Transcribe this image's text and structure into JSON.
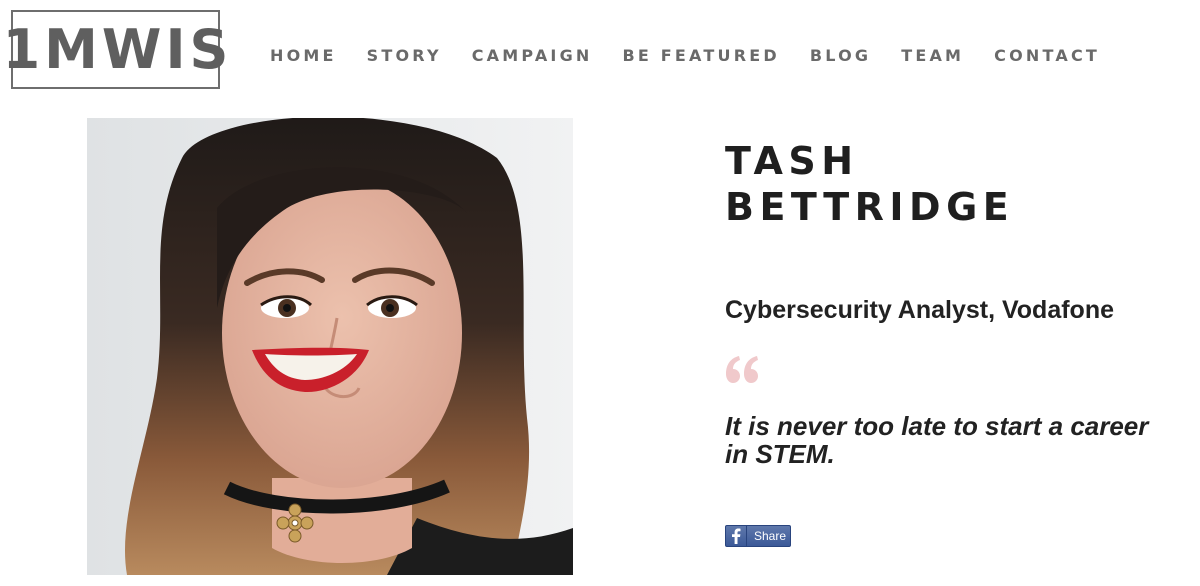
{
  "brand": {
    "logo_text": "1MWIS"
  },
  "nav": {
    "items": [
      {
        "label": "HOME"
      },
      {
        "label": "STORY"
      },
      {
        "label": "CAMPAIGN"
      },
      {
        "label": "BE FEATURED"
      },
      {
        "label": "BLOG"
      },
      {
        "label": "TEAM"
      },
      {
        "label": "CONTACT"
      }
    ]
  },
  "profile": {
    "first_name": "TASH",
    "last_name": "BETTRIDGE",
    "role": "Cybersecurity Analyst, Vodafone",
    "quote": "It is never too late to start a career in STEM.",
    "photo_icon": "portrait-photo"
  },
  "share": {
    "label": "Share",
    "icon": "facebook-icon"
  },
  "colors": {
    "logo_gray": "#5f5f5f",
    "nav_gray": "#6a6a6a",
    "heading": "#1f1f1f",
    "quote_mark_pink": "#f0c9cb",
    "facebook_blue": "#3b5998"
  }
}
